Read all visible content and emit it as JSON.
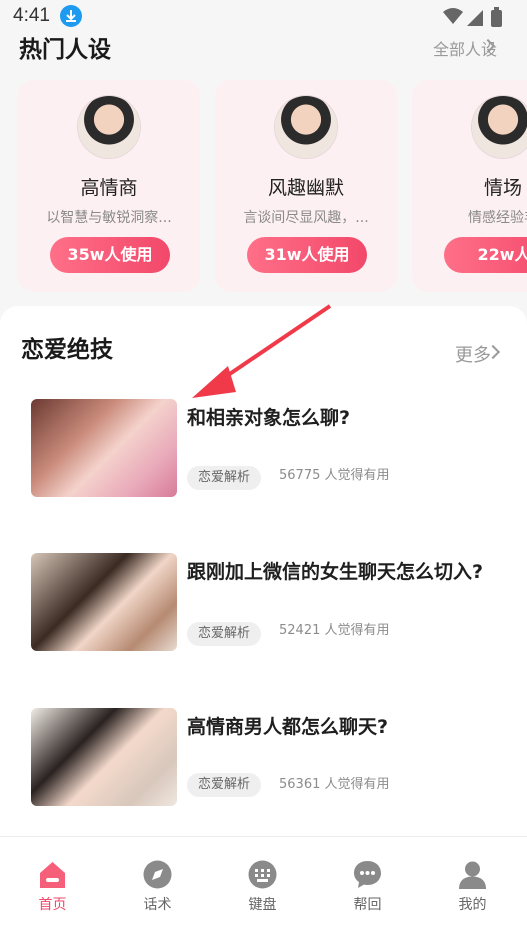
{
  "status_bar": {
    "time": "4:41"
  },
  "hot_personas": {
    "title": "热门人设",
    "all_link": "全部人设",
    "cards": [
      {
        "name": "高情商",
        "desc": "以智慧与敏锐洞察...",
        "usage": "35w人使用"
      },
      {
        "name": "风趣幽默",
        "desc": "言谈间尽显风趣，...",
        "usage": "31w人使用"
      },
      {
        "name": "情场",
        "desc": "情感经验丰",
        "usage": "22w人"
      }
    ]
  },
  "love_tips": {
    "title": "恋爱绝技",
    "more_link": "更多",
    "articles": [
      {
        "title": "和相亲对象怎么聊?",
        "tag": "恋爱解析",
        "count_text": "56775 人觉得有用"
      },
      {
        "title": "跟刚加上微信的女生聊天怎么切入?",
        "tag": "恋爱解析",
        "count_text": "52421 人觉得有用"
      },
      {
        "title": "高情商男人都怎么聊天?",
        "tag": "恋爱解析",
        "count_text": "56361 人觉得有用"
      }
    ]
  },
  "bottom_nav": {
    "items": [
      {
        "label": "首页",
        "icon": "home-icon",
        "active": true
      },
      {
        "label": "话术",
        "icon": "compass-icon",
        "active": false
      },
      {
        "label": "键盘",
        "icon": "keyboard-icon",
        "active": false
      },
      {
        "label": "帮回",
        "icon": "chat-bubble-icon",
        "active": false
      },
      {
        "label": "我的",
        "icon": "user-icon",
        "active": false
      }
    ]
  },
  "colors": {
    "accent": "#f2486a",
    "card_bg": "#fdf0f2"
  }
}
